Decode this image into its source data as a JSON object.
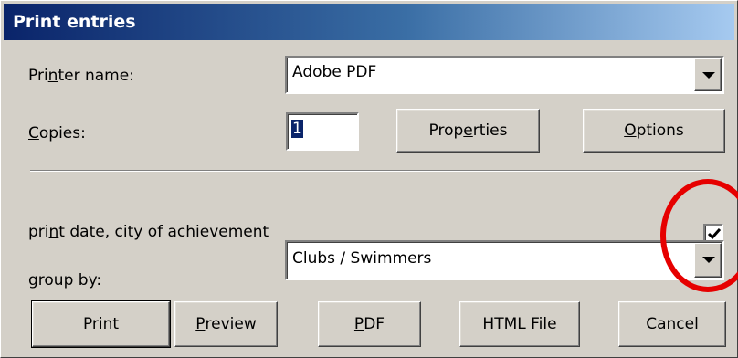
{
  "dialog": {
    "title": "Print entries"
  },
  "printer": {
    "label_pre": "Pri",
    "label_mnemonic": "n",
    "label_post": "ter name:",
    "value": "Adobe PDF"
  },
  "copies": {
    "label_mnemonic": "C",
    "label_post": "opies:",
    "value": "1"
  },
  "buttons": {
    "properties_pre": "Prop",
    "properties_mnemonic": "e",
    "properties_post": "rties",
    "options_mnemonic": "O",
    "options_post": "ptions",
    "print": "Print",
    "preview_mnemonic": "P",
    "preview_post": "review",
    "pdf_mnemonic": "P",
    "pdf_post": "DF",
    "html_file": "HTML File",
    "cancel": "Cancel"
  },
  "print_date": {
    "label_pre": "pri",
    "label_mnemonic": "n",
    "label_post": "t date, city of achievement",
    "checked": true
  },
  "group_by": {
    "label": "group by:",
    "value": "Clubs / Swimmers"
  },
  "colors": {
    "title_start": "#0a246a",
    "title_end": "#a6caf0",
    "face": "#d4d0c8",
    "highlight_circle": "#e60000"
  }
}
